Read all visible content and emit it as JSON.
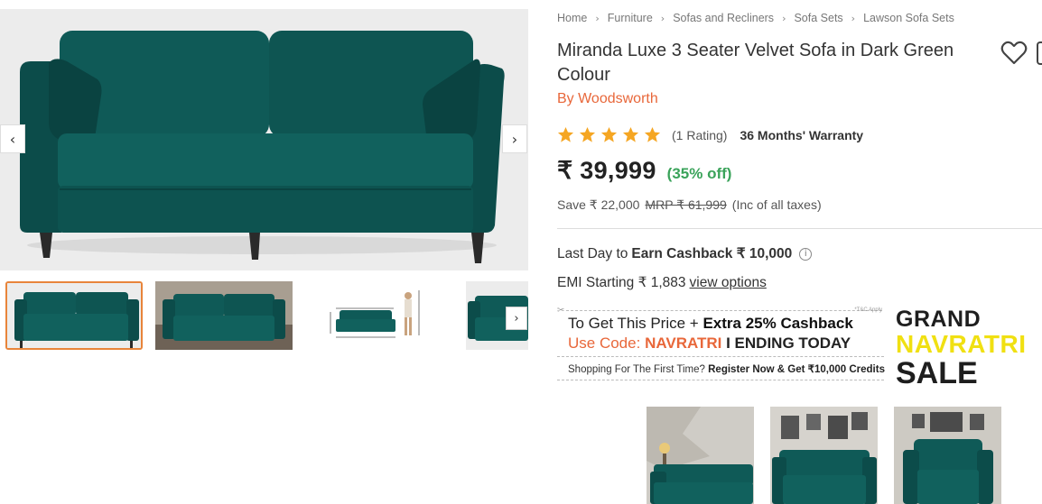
{
  "gallery": {
    "prev_icon": "chevron-left-icon",
    "next_icon": "chevron-right-icon",
    "prev_glyph": "‹",
    "next_glyph": "›",
    "thumb_next_glyph": "›",
    "colors": {
      "sofa": "#0f5a57",
      "sofa_dark": "#0a4341",
      "background": "#ececec",
      "active_border": "#e8843a"
    }
  },
  "breadcrumb": {
    "items": [
      "Home",
      "Furniture",
      "Sofas and Recliners",
      "Sofa Sets",
      "Lawson Sofa Sets"
    ],
    "separator": "›"
  },
  "product": {
    "title": "Miranda Luxe 3 Seater Velvet Sofa in Dark Green Colour",
    "brand": "By Woodsworth",
    "rating_stars": 5,
    "rating_count": "(1 Rating)",
    "warranty": "36 Months' Warranty",
    "price": "₹ 39,999",
    "discount": "(35% off)",
    "save_text": "Save ₹ 22,000",
    "mrp": "MRP ₹ 61,999",
    "tax_note": "(Inc of all taxes)",
    "colors": {
      "brand": "#e8673a",
      "discount": "#3aa35a",
      "star": "#f5a623"
    }
  },
  "cashback": {
    "prefix": "Last Day to",
    "bold": "Earn Cashback ₹ 10,000",
    "info_glyph": "i"
  },
  "emi": {
    "text": "EMI Starting ₹ 1,883",
    "link": "view options"
  },
  "offer": {
    "scissor": "✂",
    "tnc": "*T&C Apply",
    "line1_prefix": "To Get This Price +",
    "line1_bold": "Extra 25% Cashback",
    "line2_prefix": "Use Code:",
    "line2_code": "NAVRATRI",
    "line2_suffix": "I ENDING TODAY",
    "line3_prefix": "Shopping For The First Time?",
    "line3_bold": "Register Now & Get ₹10,000 Credits"
  },
  "sale_badge": {
    "grand": "GRAND",
    "navratri": "NAVRATRI",
    "sale": "SALE",
    "colors": {
      "dark": "#1e1e1e",
      "yellow": "#f0e012"
    }
  }
}
